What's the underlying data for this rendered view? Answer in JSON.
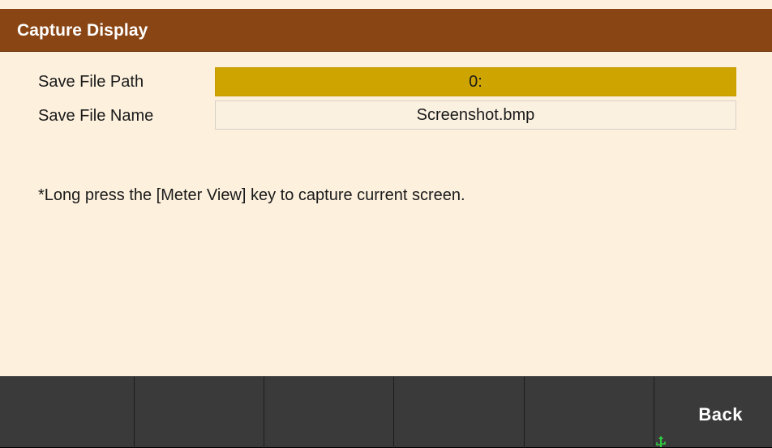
{
  "title": "Capture Display",
  "fields": {
    "path_label": "Save File Path",
    "path_value": "0:",
    "name_label": "Save File Name",
    "name_value": "Screenshot.bmp"
  },
  "note": "*Long press the [Meter View] key to capture current screen.",
  "softkeys": [
    {
      "label": ""
    },
    {
      "label": ""
    },
    {
      "label": ""
    },
    {
      "label": ""
    },
    {
      "label": ""
    },
    {
      "label": "Back"
    }
  ],
  "colors": {
    "title_bar": "#8a4514",
    "background": "#fdf1de",
    "selected_field": "#cea500",
    "softkey_bar": "#3a3a3a",
    "usb_indicator": "#2ecc40"
  },
  "icons": {
    "status": "usb-icon"
  }
}
